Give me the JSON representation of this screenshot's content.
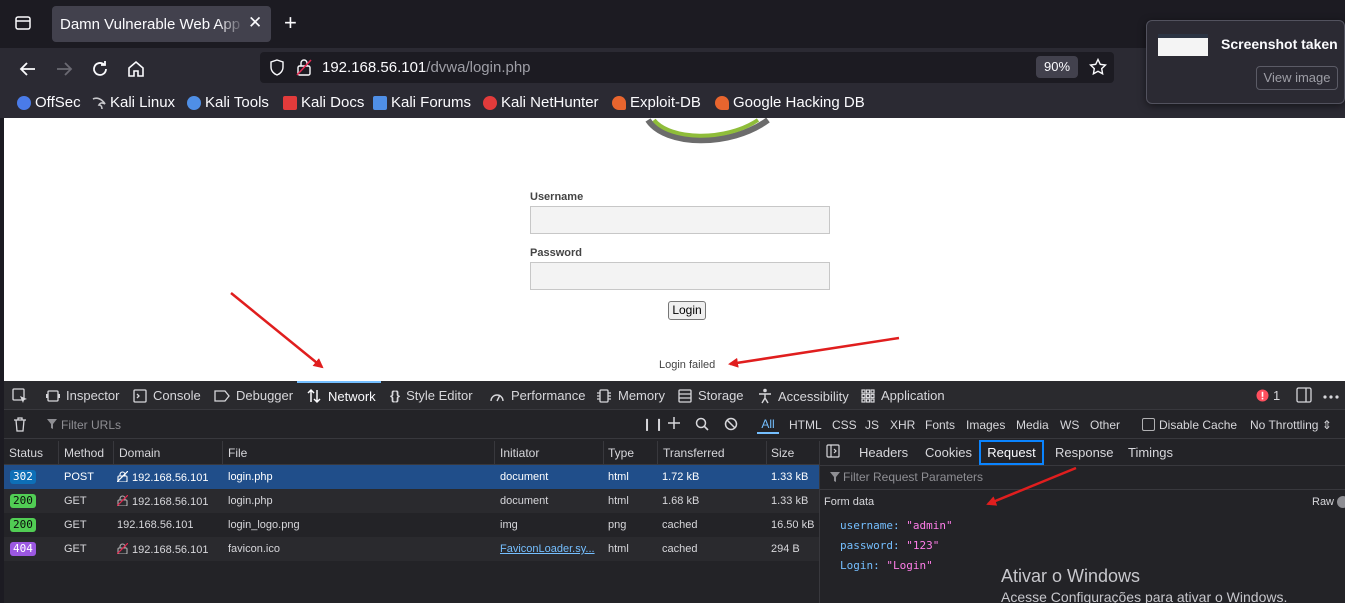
{
  "tab": {
    "title": "Damn Vulnerable Web App (D",
    "close": "✕",
    "new_tab": "+"
  },
  "url": {
    "host": "192.168.56.101",
    "path": "/dvwa/login.php",
    "zoom": "90%"
  },
  "bookmarks": [
    {
      "label": "OffSec",
      "color": "#4a7be8"
    },
    {
      "label": "Kali Linux",
      "color": "#9e9ea6"
    },
    {
      "label": "Kali Tools",
      "color": "#4f8fe6"
    },
    {
      "label": "Kali Docs",
      "color": "#e23b3b"
    },
    {
      "label": "Kali Forums",
      "color": "#4f8fe6"
    },
    {
      "label": "Kali NetHunter",
      "color": "#e23b3b"
    },
    {
      "label": "Exploit-DB",
      "color": "#e8652e"
    },
    {
      "label": "Google Hacking DB",
      "color": "#e8652e"
    }
  ],
  "screenshot_popup": {
    "title": "Screenshot taken",
    "button": "View image"
  },
  "login": {
    "username_label": "Username",
    "password_label": "Password",
    "button": "Login",
    "message": "Login failed"
  },
  "devtools": {
    "tools": [
      "Inspector",
      "Console",
      "Debugger",
      "Network",
      "Style Editor",
      "Performance",
      "Memory",
      "Storage",
      "Accessibility",
      "Application"
    ],
    "error_count": "1",
    "filter_placeholder": "Filter URLs",
    "filter_types": [
      "All",
      "HTML",
      "CSS",
      "JS",
      "XHR",
      "Fonts",
      "Images",
      "Media",
      "WS",
      "Other"
    ],
    "disable_cache": "Disable Cache",
    "throttling": "No Throttling ⇕",
    "columns": [
      "Status",
      "Method",
      "Domain",
      "File",
      "Initiator",
      "Type",
      "Transferred",
      "Size"
    ],
    "requests": [
      {
        "status": "302",
        "method": "POST",
        "domain": "192.168.56.101",
        "file": "login.php",
        "initiator": "document",
        "type": "html",
        "transferred": "1.72 kB",
        "size": "1.33 kB"
      },
      {
        "status": "200",
        "method": "GET",
        "domain": "192.168.56.101",
        "file": "login.php",
        "initiator": "document",
        "type": "html",
        "transferred": "1.68 kB",
        "size": "1.33 kB"
      },
      {
        "status": "200",
        "method": "GET",
        "domain": "192.168.56.101",
        "file": "login_logo.png",
        "initiator": "img",
        "type": "png",
        "transferred": "cached",
        "size": "16.50 kB"
      },
      {
        "status": "404",
        "method": "GET",
        "domain": "192.168.56.101",
        "file": "favicon.ico",
        "initiator": "FaviconLoader.sy...",
        "type": "html",
        "transferred": "cached",
        "size": "294 B"
      }
    ],
    "side_tabs": [
      "Headers",
      "Cookies",
      "Request",
      "Response",
      "Timings"
    ],
    "side_filter": "Filter Request Parameters",
    "form_data_label": "Form data",
    "raw_label": "Raw",
    "params": [
      {
        "key": "username:",
        "value": "\"admin\""
      },
      {
        "key": "password:",
        "value": "\"123\""
      },
      {
        "key": "Login:",
        "value": "\"Login\""
      }
    ]
  },
  "watermark": {
    "line1": "Ativar o Windows",
    "line2": "Acesse Configurações para ativar o Windows."
  },
  "colors": {
    "accent": "#0a84ff",
    "selected_row": "#204e8a",
    "arrow": "#e01e1e"
  }
}
